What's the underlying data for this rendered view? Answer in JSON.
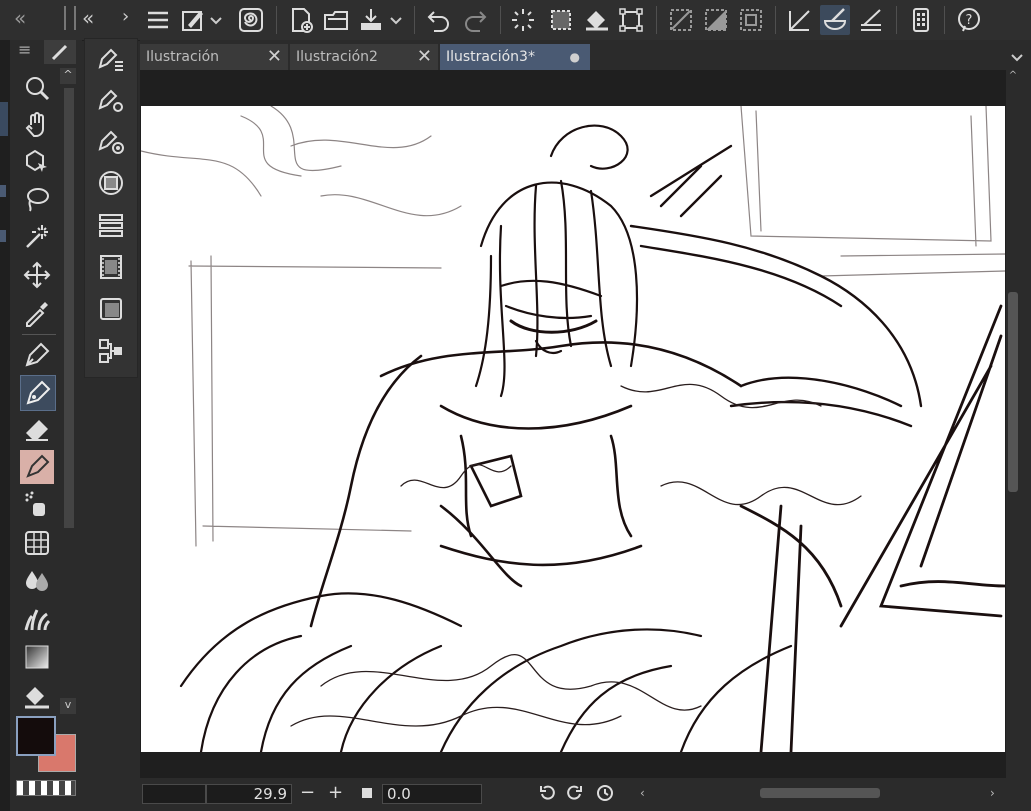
{
  "toolbar": {
    "icons": [
      "menu-icon",
      "brush-settings-icon",
      "dropdown-icon",
      "spiral-icon",
      "new-canvas-icon",
      "open-folder-icon",
      "export-icon",
      "undo-icon",
      "redo-icon",
      "loading-icon",
      "select-all-icon",
      "fill-icon",
      "transform-icon",
      "deselect-icon",
      "invert-selection-icon",
      "selection-border-icon",
      "ruler-icon",
      "ruler-pen-icon",
      "ruler-line-icon",
      "device-icon",
      "help-icon"
    ]
  },
  "tabs": [
    {
      "label": "Ilustración",
      "close": "✕"
    },
    {
      "label": "Ilustración2",
      "close": "✕"
    },
    {
      "label": "Ilustración3*",
      "close": "●"
    }
  ],
  "tools": [
    "zoom-icon",
    "hand-icon",
    "object-select-icon",
    "lasso-icon",
    "magic-wand-icon",
    "move-icon",
    "eyedropper-icon",
    "pen-icon",
    "pencil-icon",
    "eraser-icon",
    "brush-icon",
    "spray-icon",
    "grid-icon",
    "water-drop-icon",
    "grass-icon",
    "gradient-icon",
    "bucket-icon"
  ],
  "subtools": [
    "pen-list-icon",
    "pen-settings-icon",
    "pen-target-icon",
    "circle-square-icon",
    "layers-list-icon",
    "film-icon",
    "window-icon",
    "node-icon"
  ],
  "colors": {
    "main": "#140c0c",
    "sub": "#d9786c",
    "accent": "#4a5a73"
  },
  "status": {
    "zoom": "29.9",
    "minus": "−",
    "plus": "+",
    "rotation": "0.0"
  },
  "panel": {
    "collapse_left": "«",
    "collapse_right": "»",
    "menu": "≡"
  }
}
